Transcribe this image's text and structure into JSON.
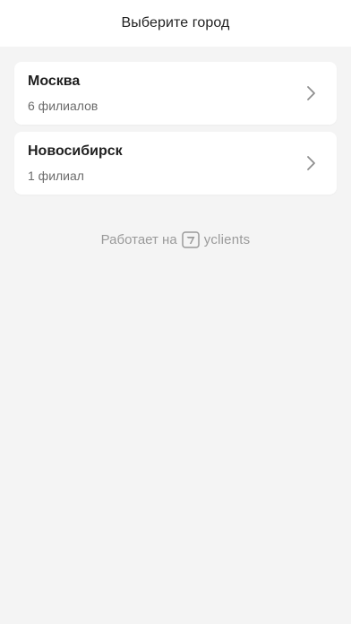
{
  "header": {
    "title": "Выберите город"
  },
  "cities": [
    {
      "name": "Москва",
      "count": "6 филиалов"
    },
    {
      "name": "Новосибирск",
      "count": "1 филиал"
    }
  ],
  "footer": {
    "powered_by": "Работает на",
    "brand": "yclients",
    "logo_icon": "yclients-logo-icon"
  },
  "colors": {
    "background": "#f4f4f4",
    "card": "#ffffff",
    "muted_text": "#9a9a9a",
    "chevron": "#8e8e8e"
  }
}
